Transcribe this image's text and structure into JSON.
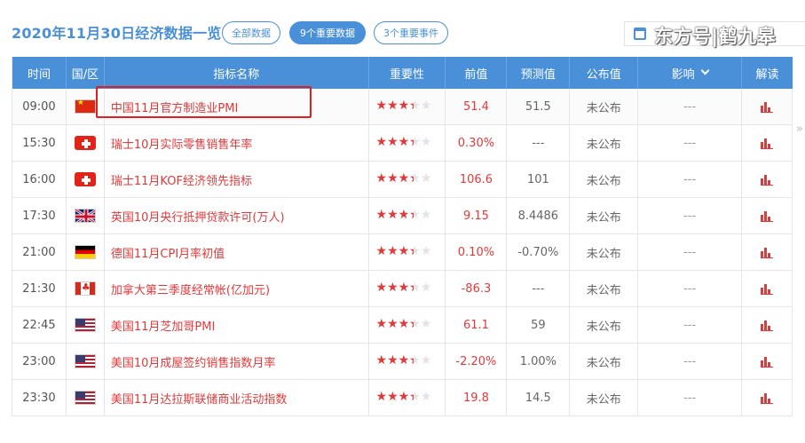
{
  "header": {
    "title": "2020年11月30日经济数据一览",
    "filters": [
      {
        "label": "全部数据",
        "active": false
      },
      {
        "label": "9个重要数据",
        "active": true
      },
      {
        "label": "3个重要事件",
        "active": false
      }
    ],
    "watermark": "东方号|鹤九皋"
  },
  "table": {
    "columns": [
      "时间",
      "国/区",
      "指标名称",
      "重要性",
      "前值",
      "预测值",
      "公布值",
      "影响",
      "解读"
    ],
    "rows": [
      {
        "time": "09:00",
        "flag": "cn",
        "name": "中国11月官方制造业PMI",
        "stars": 3,
        "prev": "51.4",
        "forecast": "51.5",
        "actual": "未公布",
        "impact": "---"
      },
      {
        "time": "15:30",
        "flag": "ch",
        "name": "瑞士10月实际零售销售年率",
        "stars": 3,
        "prev": "0.30%",
        "forecast": "---",
        "actual": "未公布",
        "impact": "---"
      },
      {
        "time": "16:00",
        "flag": "ch",
        "name": "瑞士11月KOF经济领先指标",
        "stars": 3,
        "prev": "106.6",
        "forecast": "101",
        "actual": "未公布",
        "impact": "---"
      },
      {
        "time": "17:30",
        "flag": "uk",
        "name": "英国10月央行抵押贷款许可(万人)",
        "stars": 3,
        "prev": "9.15",
        "forecast": "8.4486",
        "actual": "未公布",
        "impact": "---"
      },
      {
        "time": "21:00",
        "flag": "de",
        "name": "德国11月CPI月率初值",
        "stars": 3,
        "prev": "0.10%",
        "forecast": "-0.70%",
        "actual": "未公布",
        "impact": "---"
      },
      {
        "time": "21:30",
        "flag": "ca",
        "name": "加拿大第三季度经常帐(亿加元)",
        "stars": 3,
        "prev": "-86.3",
        "forecast": "---",
        "actual": "未公布",
        "impact": "---"
      },
      {
        "time": "22:45",
        "flag": "us",
        "name": "美国11月芝加哥PMI",
        "stars": 3,
        "prev": "61.1",
        "forecast": "59",
        "actual": "未公布",
        "impact": "---"
      },
      {
        "time": "23:00",
        "flag": "us",
        "name": "美国10月成屋签约销售指数月率",
        "stars": 3,
        "prev": "-2.20%",
        "forecast": "1.00%",
        "actual": "未公布",
        "impact": "---"
      },
      {
        "time": "23:30",
        "flag": "us",
        "name": "美国11月达拉斯联储商业活动指数",
        "stars": 3,
        "prev": "19.8",
        "forecast": "14.5",
        "actual": "未公布",
        "impact": "---"
      }
    ]
  },
  "colors": {
    "accent": "#4a90d9",
    "red": "#e2393a",
    "highlight": "#e02020"
  }
}
